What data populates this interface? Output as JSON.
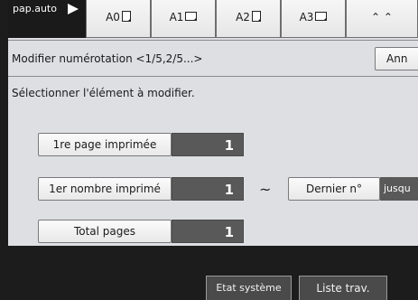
{
  "paper_bar": {
    "auto_label": "pap.auto",
    "sizes": [
      {
        "label": "A0",
        "orientation": "portrait"
      },
      {
        "label": "A1",
        "orientation": "landscape"
      },
      {
        "label": "A2",
        "orientation": "portrait"
      },
      {
        "label": "A3",
        "orientation": "landscape"
      }
    ]
  },
  "dialog": {
    "title": "Modifier numérotation <1/5,2/5...>",
    "cancel_label": "Ann",
    "instruction": "Sélectionner l'élément à modifier."
  },
  "fields": {
    "first_page_printed": {
      "label": "1re page imprimée",
      "value": "1"
    },
    "first_number_printed": {
      "label": "1er nombre imprimé",
      "value": "1"
    },
    "total_pages": {
      "label": "Total pages",
      "value": "1"
    }
  },
  "range": {
    "separator": "~",
    "last_number_label": "Dernier n°",
    "until_label": "jusqu"
  },
  "status_bar": {
    "system_status_label": "Etat système",
    "job_list_label": "Liste trav."
  },
  "colors": {
    "panel_bg": "#dedfe3",
    "value_bg": "#595959",
    "status_bar_bg": "#1c1c1c"
  }
}
